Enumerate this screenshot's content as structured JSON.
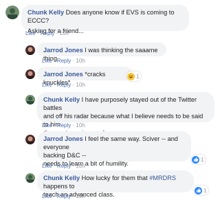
{
  "comments": [
    {
      "author": "Chunk Kelly",
      "line1": "Does anyone know if EVS is coming to ECCC?",
      "line2": "Asking for a friend...",
      "like": "Like",
      "reply": "Reply",
      "time": "10h"
    },
    {
      "author": "Jarrod Jones",
      "line1": "I was thinking the saaame thing.",
      "like": "Like",
      "reply": "Reply",
      "time": "10h"
    },
    {
      "author": "Jarrod Jones",
      "line1": "*cracks knuckles*",
      "like": "Like",
      "reply": "Reply",
      "time": "10h",
      "reaction_count": "1",
      "reaction_icon": "haha-reaction-icon"
    },
    {
      "author": "Chunk Kelly",
      "line1": "I have purposely stayed out of the Twitter battles",
      "line2": "and off his radar because what I believe needs to be said to him",
      "line3": "does not require words.",
      "like": "Like",
      "reply": "Reply",
      "time": "10h"
    },
    {
      "author": "Jarrod Jones",
      "line1": "I feel the same way. Sciver -- and everyone",
      "line2": "backing D&C --",
      "line3": "needs to learn a bit of humility.",
      "like": "Like",
      "reply": "Reply",
      "time": "10h",
      "reaction_count": "1",
      "reaction_icon": "like-reaction-icon"
    },
    {
      "author": "Chunk Kelly",
      "line1": "How lucky for them that",
      "hashtag": "#MRDRS",
      "line1b": "happens to",
      "line2": "teach an advanced class.",
      "like": "Like",
      "reply": "Reply",
      "time": "10h",
      "reaction_count": "1",
      "reaction_icon": "like-reaction-icon"
    }
  ],
  "separator": "·",
  "colors": {
    "author": "#385898",
    "bubble": "#f2f3f5",
    "meta": "#90949c",
    "like_badge": "#2d88ff",
    "haha_badge": "#f7c53b"
  }
}
